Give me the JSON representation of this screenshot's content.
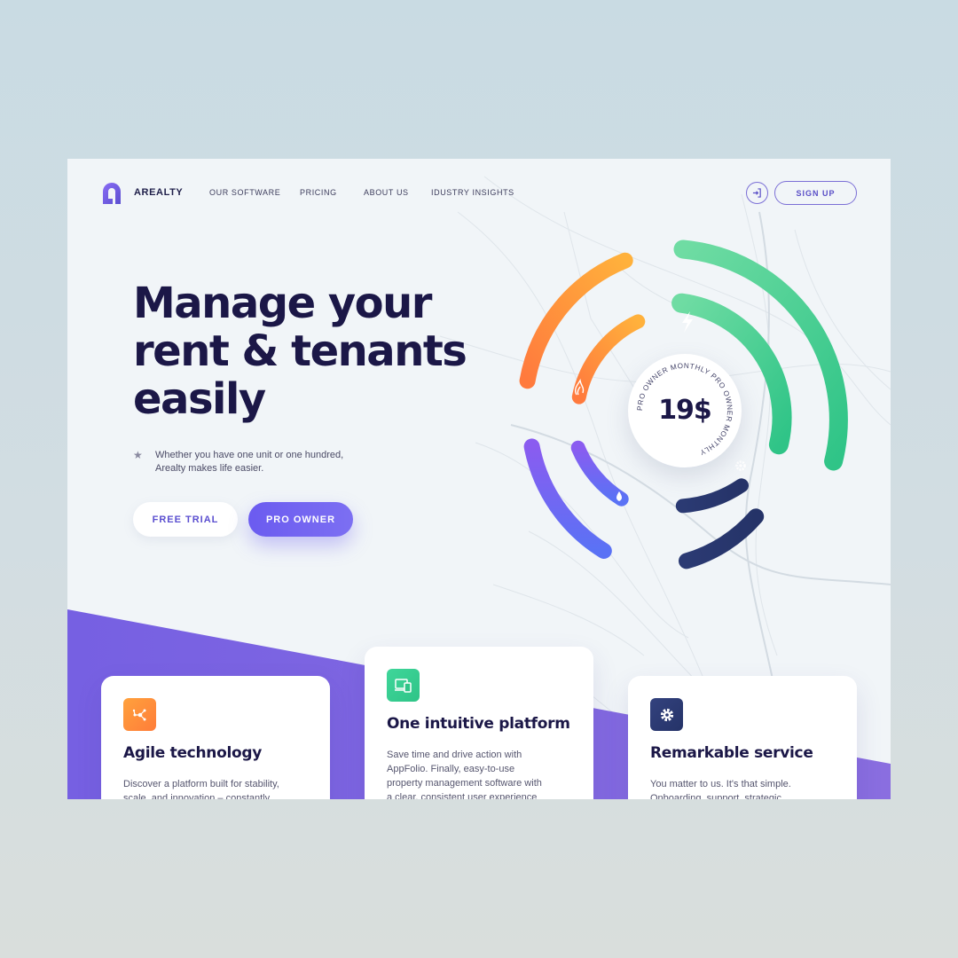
{
  "brand": {
    "name": "AREALTY",
    "logo_icon": "arealty-logo-icon"
  },
  "nav": {
    "items": [
      {
        "label": "OUR SOFTWARE"
      },
      {
        "label": "PRICING"
      },
      {
        "label": "ABOUT US"
      },
      {
        "label": "IDUSTRY INSIGHTS"
      }
    ],
    "login_icon": "login-icon",
    "signup_label": "SIGN UP"
  },
  "hero": {
    "title_lines": [
      "Manage your",
      "rent & tenants",
      "easily"
    ],
    "subtitle_lines": [
      "Whether you have one unit or one hundred,",
      "Arealty makes life easier."
    ],
    "bullet_icon": "star-icon",
    "trial_label": "FREE TRIAL",
    "pro_label": "PRO OWNER"
  },
  "pricing_badge": {
    "price": "19$",
    "ring_text": "PRO OWNER MONTHLY PRO OWNER MONTHLY "
  },
  "dial_icons": [
    "lightning-icon",
    "flame-icon",
    "drop-icon",
    "gear-icon"
  ],
  "colors": {
    "primary": "#6b5bf0",
    "band": "#7d6ae0",
    "navy": "#1b1747",
    "green": "#3ccf8e",
    "orange": "#ff9a3c",
    "dark_blue": "#2b3a73"
  },
  "features": [
    {
      "icon": "network-icon",
      "title": "Agile technology",
      "text_lines": [
        "Discover a platform built for stability,",
        "scale, and innovation – constantly"
      ]
    },
    {
      "icon": "devices-icon",
      "title": "One intuitive platform",
      "text_lines": [
        "Save time and drive action with",
        "AppFolio. Finally, easy-to-use",
        "property management software with",
        "a clear, consistent user experience"
      ]
    },
    {
      "icon": "gear-icon",
      "title": "Remarkable service",
      "text_lines": [
        "You matter to us. It's that simple.",
        "Onboarding, support, strategic"
      ]
    }
  ]
}
